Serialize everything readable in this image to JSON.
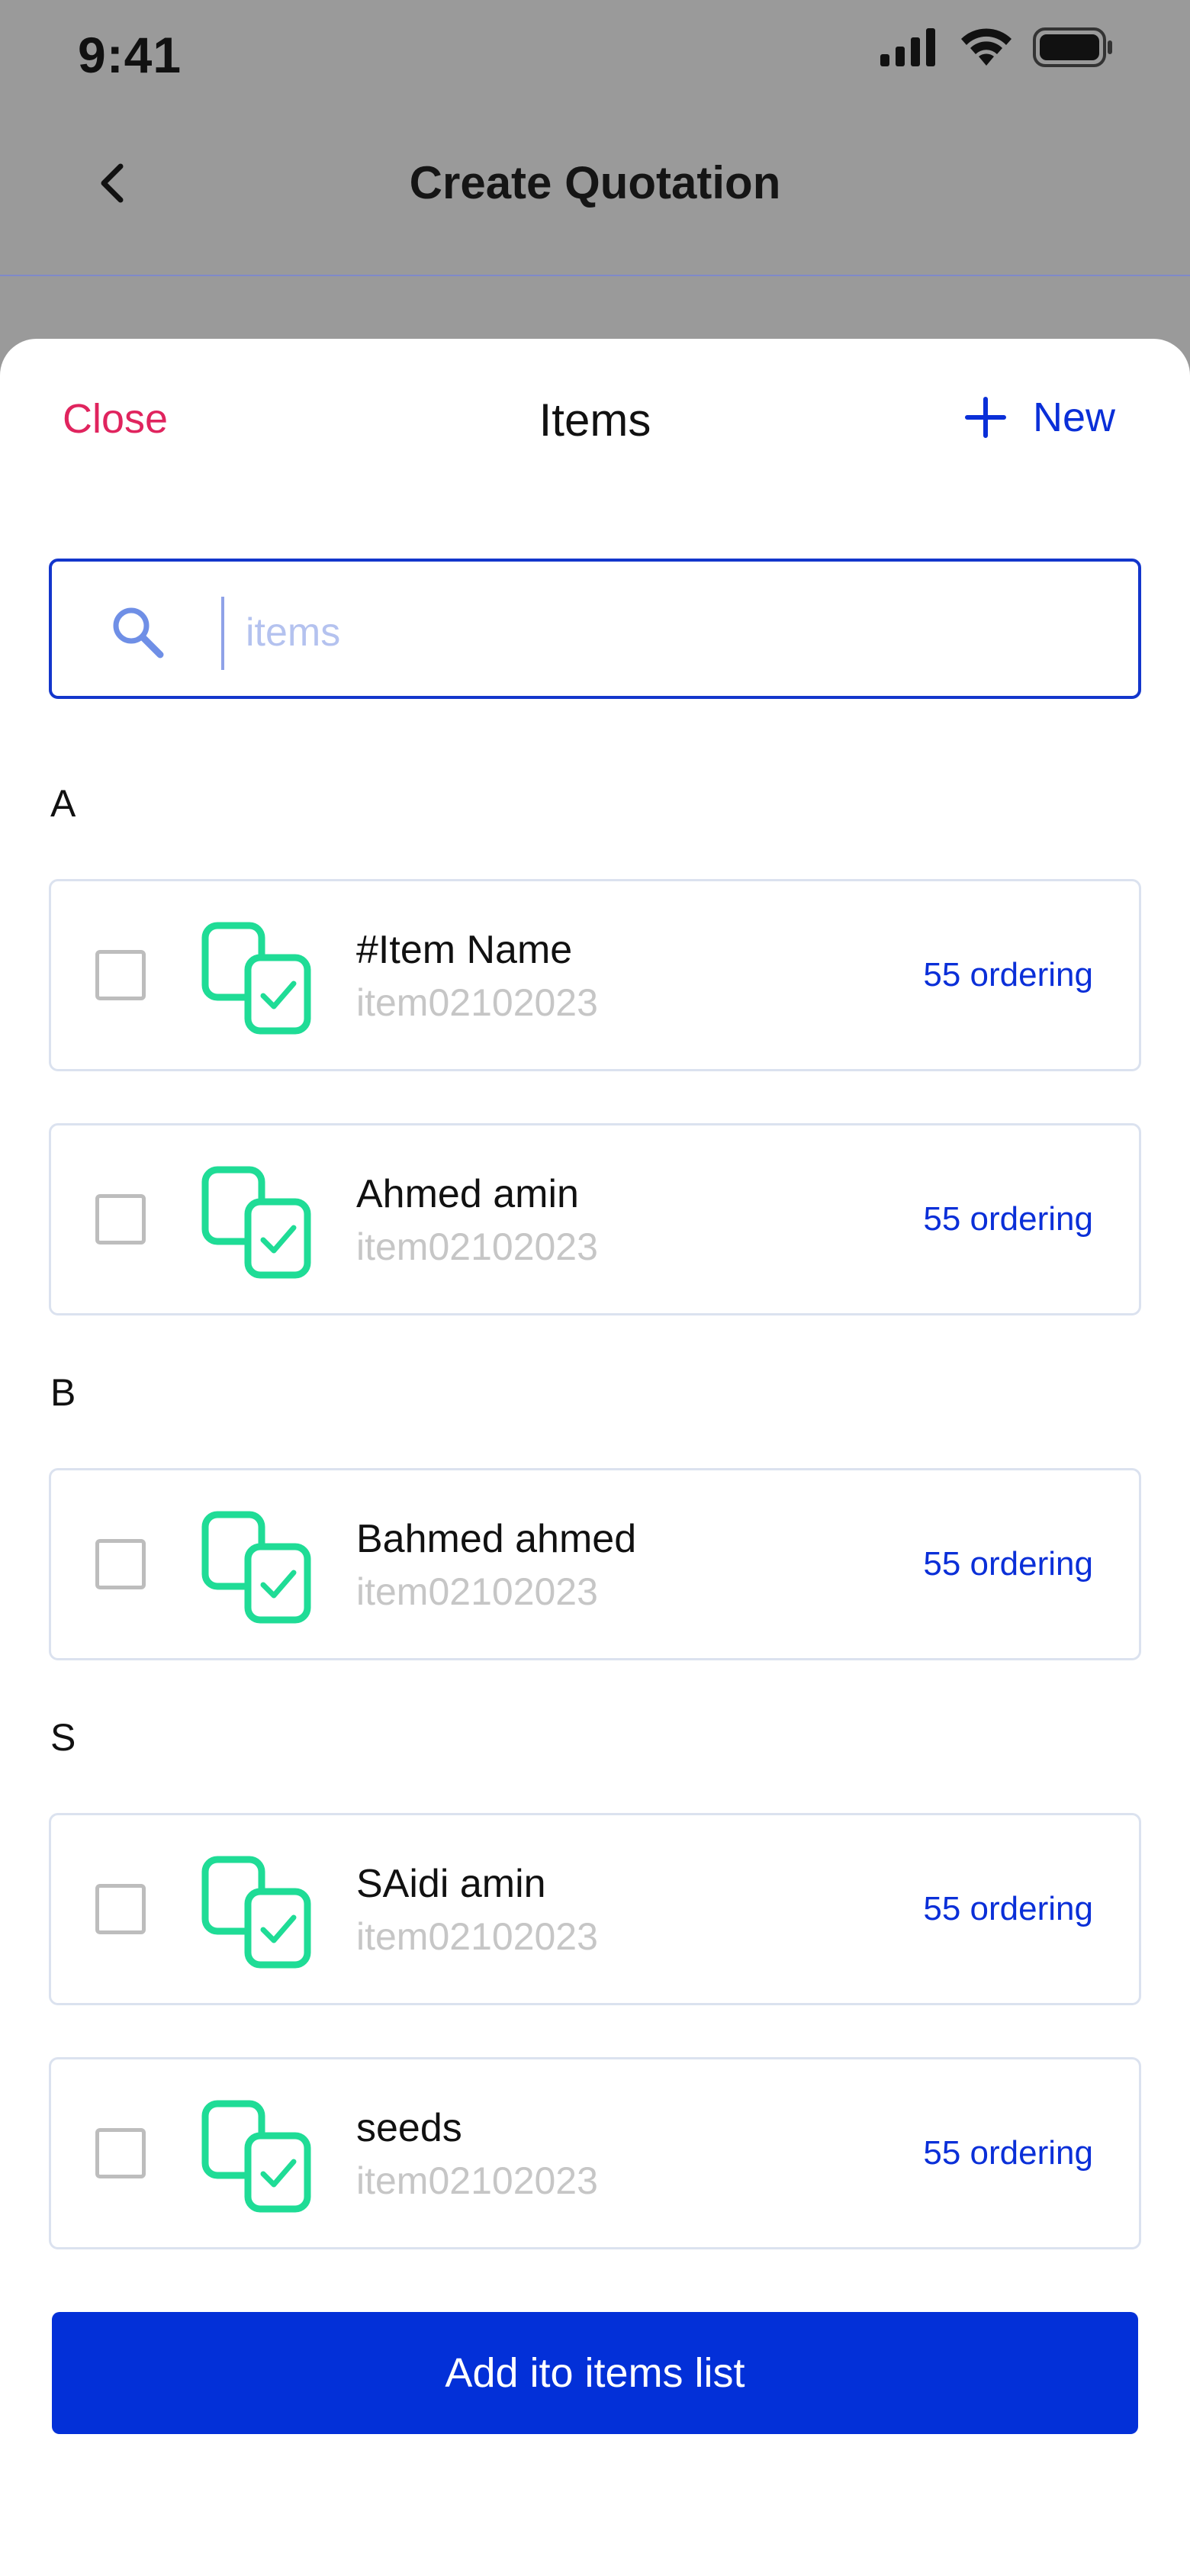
{
  "status_bar": {
    "time": "9:41"
  },
  "background_screen": {
    "title": "Create Quotation"
  },
  "sheet": {
    "close_label": "Close",
    "title": "Items",
    "new_label": "New"
  },
  "search": {
    "placeholder": "items",
    "value": ""
  },
  "sections": [
    {
      "letter": "A"
    },
    {
      "letter": "B"
    },
    {
      "letter": "S"
    }
  ],
  "items": [
    {
      "name": "#Item Name",
      "code": "item02102023",
      "ordering": "55 ordering",
      "checked": false
    },
    {
      "name": "Ahmed amin",
      "code": "item02102023",
      "ordering": "55 ordering",
      "checked": false
    },
    {
      "name": "Bahmed ahmed",
      "code": "item02102023",
      "ordering": "55 ordering",
      "checked": false
    },
    {
      "name": "SAidi amin",
      "code": "item02102023",
      "ordering": "55 ordering",
      "checked": false
    },
    {
      "name": "seeds",
      "code": "item02102023",
      "ordering": "55 ordering",
      "checked": false
    }
  ],
  "add_button_label": "Add ito items list",
  "colors": {
    "accent": "#0330d8",
    "close": "#e0245e",
    "item_icon": "#1fdc96",
    "overlay": "#9a9a9a"
  },
  "icons": [
    "back-icon",
    "signal-icon",
    "wifi-icon",
    "battery-icon",
    "plus-icon",
    "search-icon",
    "items-icon",
    "checkbox-icon"
  ]
}
